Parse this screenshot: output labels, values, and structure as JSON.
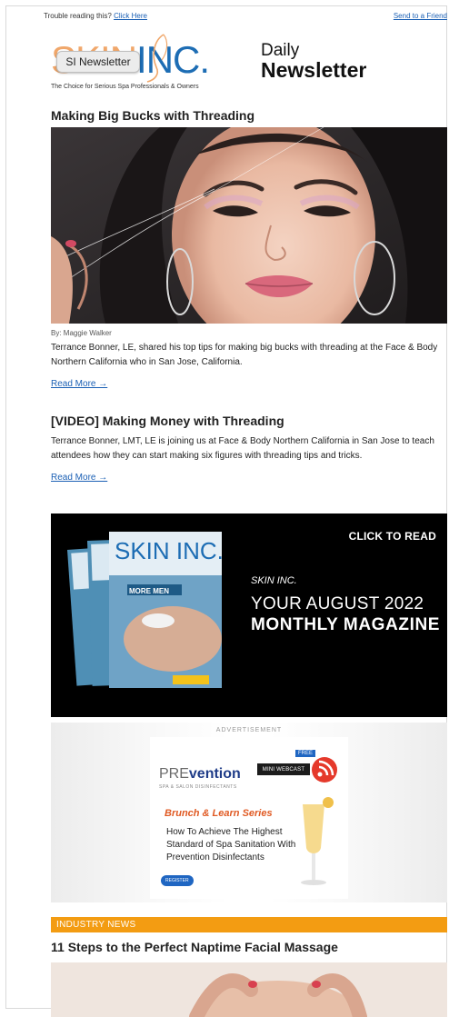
{
  "header": {
    "trouble_text": "Trouble reading this?",
    "click_here": "Click Here",
    "send_friend": "Send to a Friend"
  },
  "logo": {
    "skin": "SKIN",
    "inc": "INC.",
    "tagline": "The Choice for Serious Spa Professionals & Owners",
    "badge": "SI Newsletter"
  },
  "masthead": {
    "line1": "Daily",
    "line2": "Newsletter"
  },
  "articles": [
    {
      "title": "Making Big Bucks with Threading",
      "byline": "By: Maggie Walker",
      "summary": "Terrance Bonner, LE, shared his top tips for making big bucks with threading at the Face & Body Northern California who in San Jose, California.",
      "read_more": "Read More →"
    },
    {
      "title": "[VIDEO] Making Money with Threading",
      "summary": "Terrance Bonner, LMT, LE is joining us at Face & Body Northern California in San Jose to teach attendees how they can start making six figures with threading tips and tricks.",
      "read_more": "Read More →"
    }
  ],
  "magazine_banner": {
    "click_to_read": "CLICK TO READ",
    "brand": "SKIN INC.",
    "issue": "YOUR AUGUST 2022",
    "subtitle": "MONTHLY MAGAZINE",
    "cover_title": "SKIN INC.",
    "cover_headline": "MORE MEN"
  },
  "advertisement": {
    "label": "ADVERTISEMENT",
    "brand_pre": "PRE",
    "brand_rest": "vention",
    "brand_sub": "SPA & SALON DISINFECTANTS",
    "free": "FREE",
    "mini_webcast": "MINI WEBCAST",
    "series": "Brunch & Learn Series",
    "headline": "How To Achieve The Highest Standard of Spa Sanitation With Prevention Disinfectants",
    "register": "REGISTER"
  },
  "sections": {
    "industry_news": "INDUSTRY NEWS",
    "article_title": "11 Steps to the Perfect Naptime Facial Massage"
  },
  "colors": {
    "link": "#1a5fb4",
    "section_bar": "#f39c12",
    "logo_orange": "#f0a76b",
    "logo_blue": "#1d6db4"
  }
}
